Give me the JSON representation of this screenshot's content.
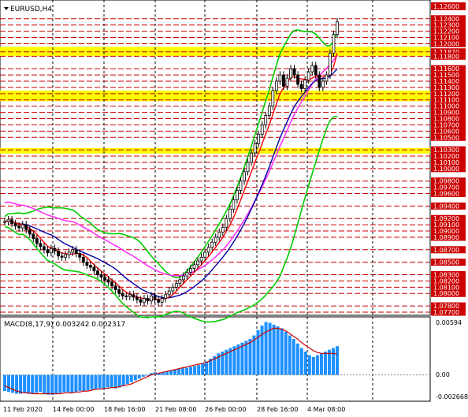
{
  "window": {
    "symbol_title": "EURUSD,H4",
    "menu_icon": "triangle-down-icon"
  },
  "price_panel": {
    "current_price": "1.12600",
    "price_labels": [
      "1.12400",
      "1.12300",
      "1.12200",
      "1.12100",
      "1.12000",
      "1.11870",
      "1.11800",
      "1.11600",
      "1.11500",
      "1.11400",
      "1.11300",
      "1.11200",
      "1.11100",
      "1.11000",
      "1.10900",
      "1.10800",
      "1.10700",
      "1.10600",
      "1.10500",
      "1.10300",
      "1.10200",
      "1.10100",
      "1.10000",
      "1.09800",
      "1.09700",
      "1.09600",
      "1.09400",
      "1.09200",
      "1.09100",
      "1.09000",
      "1.08900",
      "1.08700",
      "1.08500",
      "1.08300",
      "1.08200",
      "1.08100",
      "1.08000",
      "1.07800",
      "1.07700"
    ],
    "highlight_bands": [
      {
        "from": 1.118,
        "to": 1.1195
      },
      {
        "from": 1.1108,
        "to": 1.1125
      },
      {
        "from": 1.1024,
        "to": 1.1033
      }
    ],
    "colors": {
      "band": "#ffff00",
      "level_line": "#cc0000",
      "ma_fast": "#ff0000",
      "ma_slow": "#0000aa",
      "bollinger": "#00cc00",
      "envelope": "#ff33ff",
      "envelope_dots": "#ff9999",
      "candles": "#000000",
      "label_bg": "#cc0000"
    }
  },
  "macd_panel": {
    "label": "MACD(8,17,9) 0.003242 0.002317",
    "scale_top": "0.00594",
    "scale_zero": "0.00",
    "scale_bottom": "-0.002668",
    "colors": {
      "histogram": "#1e90ff",
      "signal": "#cc0000"
    }
  },
  "time_axis": {
    "labels": [
      "11 Feb 2020",
      "14 Feb 00:00",
      "18 Feb 16:00",
      "21 Feb 08:00",
      "26 Feb 00:00",
      "28 Feb 16:00",
      "4 Mar 08:00"
    ]
  },
  "chart_data": {
    "type": "candlestick",
    "title": "EURUSD,H4",
    "ylim": [
      1.077,
      1.1265
    ],
    "closes": [
      1.0915,
      1.0918,
      1.0912,
      1.0908,
      1.0905,
      1.091,
      1.0902,
      1.0895,
      1.0888,
      1.088,
      1.0875,
      1.087,
      1.0865,
      1.0872,
      1.0868,
      1.086,
      1.0858,
      1.0862,
      1.0866,
      1.087,
      1.0864,
      1.0858,
      1.085,
      1.0845,
      1.0842,
      1.0836,
      1.083,
      1.0826,
      1.0822,
      1.0818,
      1.0812,
      1.0806,
      1.08,
      1.0796,
      1.0795,
      1.0798,
      1.0794,
      1.079,
      1.0786,
      1.0792,
      1.0788,
      1.0796,
      1.079,
      1.0786,
      1.0792,
      1.0798,
      1.0804,
      1.081,
      1.0816,
      1.0822,
      1.0828,
      1.0834,
      1.084,
      1.0846,
      1.0852,
      1.0858,
      1.0866,
      1.0874,
      1.0882,
      1.089,
      1.0898,
      1.0906,
      1.092,
      1.0935,
      1.095,
      1.0965,
      1.098,
      1.0995,
      1.101,
      1.1025,
      1.104,
      1.1055,
      1.107,
      1.1085,
      1.11,
      1.1125,
      1.114,
      1.115,
      1.1132,
      1.1145,
      1.116,
      1.115,
      1.1135,
      1.1128,
      1.1142,
      1.1155,
      1.1165,
      1.115,
      1.113,
      1.114,
      1.115,
      1.1185,
      1.1215,
      1.1235
    ],
    "macd": [
      -0.0018,
      -0.0019,
      -0.002,
      -0.0021,
      -0.0021,
      -0.002,
      -0.0021,
      -0.0021,
      -0.002,
      -0.0019,
      -0.0021,
      -0.0022,
      -0.0022,
      -0.0021,
      -0.002,
      -0.0019,
      -0.0019,
      -0.002,
      -0.0019,
      -0.0018,
      -0.0018,
      -0.0017,
      -0.0016,
      -0.0016,
      -0.0015,
      -0.0016,
      -0.0014,
      -0.0014,
      -0.0015,
      -0.0014,
      -0.0012,
      -0.001,
      -0.0008,
      -0.0006,
      -0.0004,
      -0.0002,
      0.0,
      0.0002,
      0.0003,
      0.0002,
      0.0003,
      0.0004,
      0.0005,
      0.0006,
      0.0007,
      0.0008,
      0.0008,
      0.0009,
      0.001,
      0.0011,
      0.0013,
      0.0015,
      0.0018,
      0.0021,
      0.0024,
      0.0026,
      0.0028,
      0.003,
      0.0032,
      0.0034,
      0.0036,
      0.0038,
      0.004,
      0.0044,
      0.005,
      0.0055,
      0.0059,
      0.0058,
      0.0056,
      0.0054,
      0.0052,
      0.0048,
      0.0044,
      0.004,
      0.0035,
      0.003,
      0.0026,
      0.0022,
      0.002,
      0.0022,
      0.0024,
      0.0026,
      0.0028,
      0.003,
      0.0032
    ],
    "signal": [
      -0.0012,
      -0.0014,
      -0.0016,
      -0.0018,
      -0.0019,
      -0.002,
      -0.002,
      -0.0021,
      -0.0021,
      -0.0021,
      -0.0021,
      -0.0021,
      -0.0021,
      -0.0021,
      -0.0021,
      -0.002,
      -0.002,
      -0.002,
      -0.0019,
      -0.0019,
      -0.0018,
      -0.0018,
      -0.0017,
      -0.0016,
      -0.0016,
      -0.0015,
      -0.0015,
      -0.0014,
      -0.0014,
      -0.0013,
      -0.0012,
      -0.0011,
      -0.001,
      -0.0008,
      -0.0006,
      -0.0004,
      -0.0002,
      0.0,
      0.0001,
      0.0002,
      0.0003,
      0.0004,
      0.0005,
      0.0006,
      0.0007,
      0.0008,
      0.0009,
      0.001,
      0.0011,
      0.0012,
      0.0013,
      0.0014,
      0.0016,
      0.0018,
      0.002,
      0.0022,
      0.0024,
      0.0026,
      0.0028,
      0.003,
      0.0032,
      0.0034,
      0.0036,
      0.0039,
      0.0042,
      0.0045,
      0.0048,
      0.005,
      0.0052,
      0.0052,
      0.0051,
      0.0049,
      0.0046,
      0.0043,
      0.004,
      0.0036,
      0.0033,
      0.003,
      0.0027,
      0.0025,
      0.0024,
      0.0024,
      0.0024,
      0.0024,
      0.0023
    ]
  }
}
